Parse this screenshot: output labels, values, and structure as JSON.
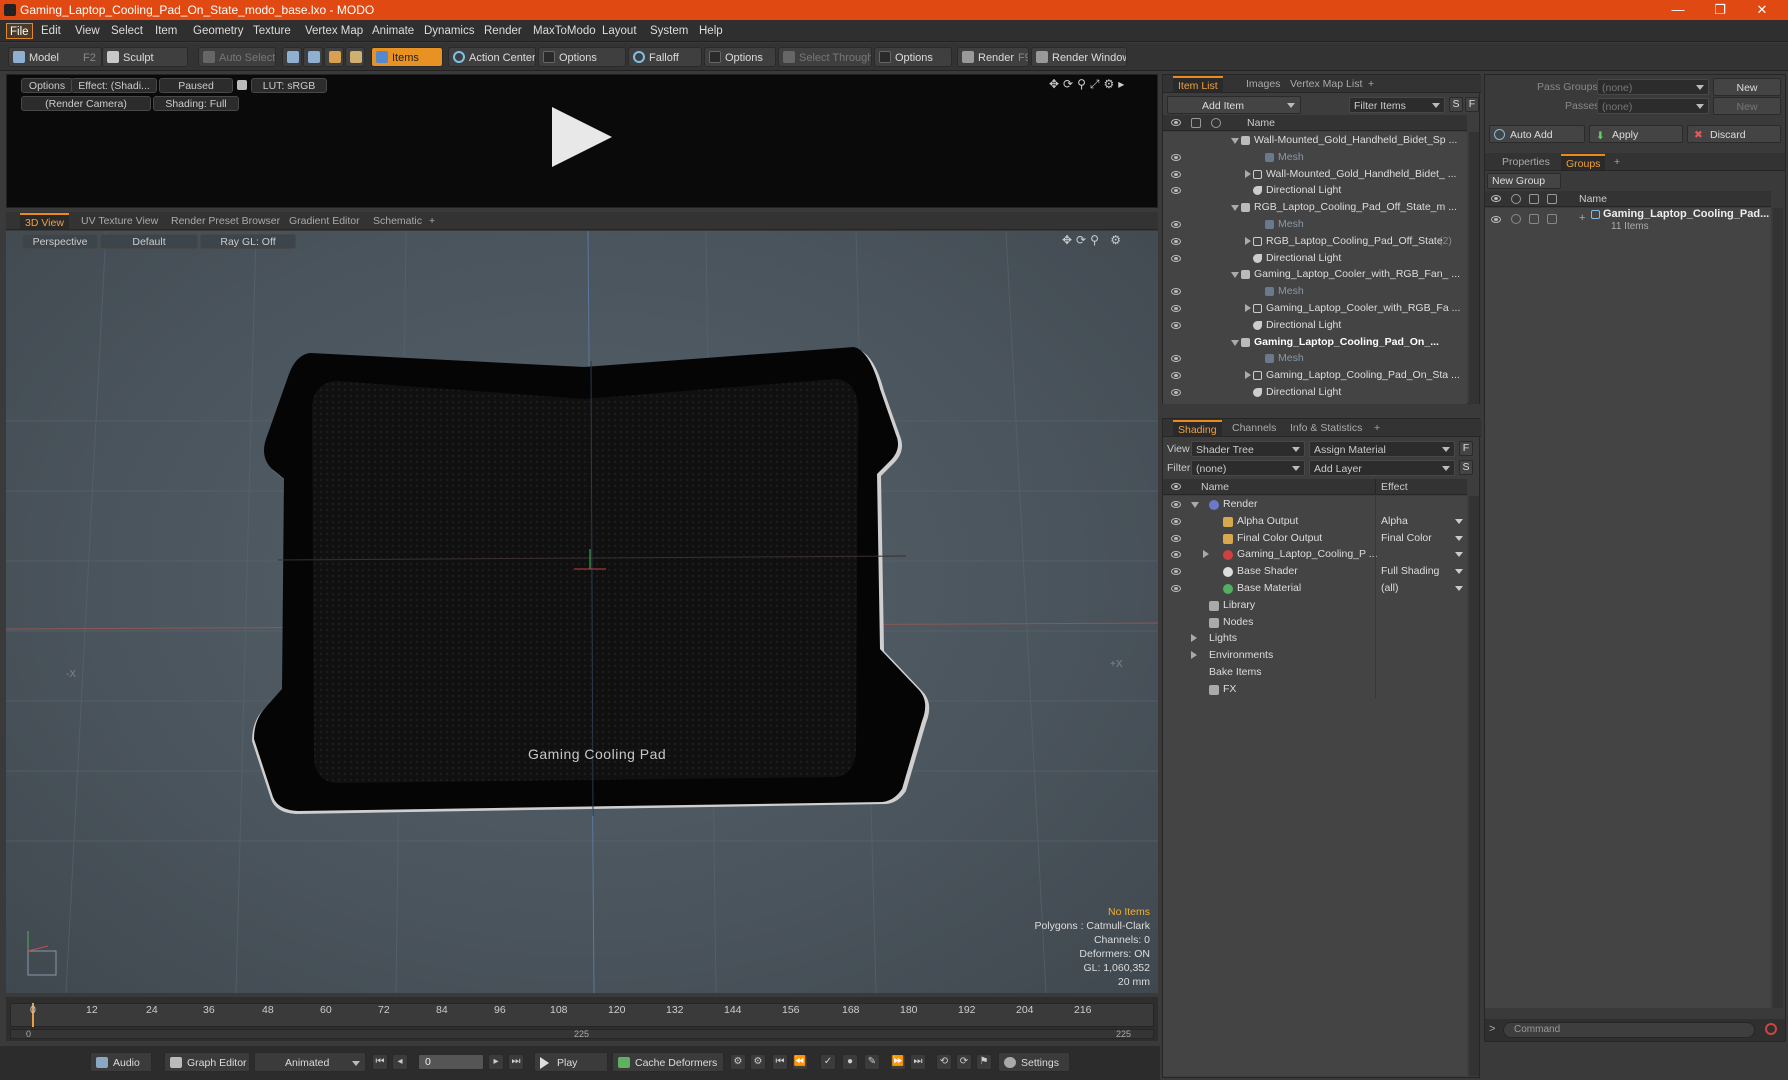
{
  "window": {
    "title": "Gaming_Laptop_Cooling_Pad_On_State_modo_base.lxo - MODO",
    "min": "—",
    "restore": "❐",
    "close": "✕"
  },
  "menu": [
    "File",
    "Edit",
    "View",
    "Select",
    "Item",
    "Geometry",
    "Texture",
    "Vertex Map",
    "Animate",
    "Dynamics",
    "Render",
    "MaxToModo",
    "Layout",
    "System",
    "Help"
  ],
  "toolbar": {
    "model": "Model",
    "model_key": "F2",
    "sculpt": "Sculpt",
    "auto_select": "Auto Select",
    "items": "Items",
    "action_center": "Action Center",
    "options1": "Options",
    "falloff": "Falloff",
    "options2": "Options",
    "select_through": "Select Through",
    "options3": "Options",
    "render": "Render",
    "render_key": "F9",
    "render_window": "Render Window"
  },
  "preview": {
    "options": "Options",
    "effect": "Effect: (Shadi...",
    "paused": "Paused",
    "lut": "LUT: sRGB",
    "camera": "(Render Camera)",
    "shading": "Shading: Full"
  },
  "viewport_tabs": [
    "3D View",
    "UV Texture View",
    "Render Preset Browser",
    "Gradient Editor",
    "Schematic",
    "+"
  ],
  "viewport": {
    "perspective": "Perspective",
    "default": "Default",
    "raygl": "Ray GL: Off",
    "pad_label": "Gaming Cooling Pad",
    "axis_neg_x": "-X",
    "axis_pos_x": "+X"
  },
  "viewport_status": {
    "no_items": "No Items",
    "polygons": "Polygons : Catmull-Clark",
    "channels": "Channels: 0",
    "deformers": "Deformers: ON",
    "gl": "GL: 1,060,352",
    "scale": "20 mm"
  },
  "item_list": {
    "tabs": [
      "Item List",
      "Images",
      "Vertex Map List",
      "+"
    ],
    "add_item": "Add Item",
    "filter_items": "Filter Items",
    "s": "S",
    "f": "F",
    "col_name": "Name",
    "rows": [
      {
        "label": "Wall-Mounted_Gold_Handheld_Bidet_Sp ...",
        "indent": 0,
        "kind": "scene"
      },
      {
        "label": "Mesh",
        "indent": 2,
        "kind": "mesh"
      },
      {
        "label": "Wall-Mounted_Gold_Handheld_Bidet_ ...",
        "indent": 1,
        "kind": "group"
      },
      {
        "label": "Directional Light",
        "indent": 1,
        "kind": "light"
      },
      {
        "label": "RGB_Laptop_Cooling_Pad_Off_State_m ...",
        "indent": 0,
        "kind": "scene"
      },
      {
        "label": "Mesh",
        "indent": 2,
        "kind": "mesh"
      },
      {
        "label": "RGB_Laptop_Cooling_Pad_Off_State",
        "indent": 1,
        "kind": "group",
        "suffix": "(2)"
      },
      {
        "label": "Directional Light",
        "indent": 1,
        "kind": "light"
      },
      {
        "label": "Gaming_Laptop_Cooler_with_RGB_Fan_ ...",
        "indent": 0,
        "kind": "scene"
      },
      {
        "label": "Mesh",
        "indent": 2,
        "kind": "mesh"
      },
      {
        "label": "Gaming_Laptop_Cooler_with_RGB_Fa ...",
        "indent": 1,
        "kind": "group"
      },
      {
        "label": "Directional Light",
        "indent": 1,
        "kind": "light"
      },
      {
        "label": "Gaming_Laptop_Cooling_Pad_On_...",
        "indent": 0,
        "kind": "scene",
        "bold": true
      },
      {
        "label": "Mesh",
        "indent": 2,
        "kind": "mesh"
      },
      {
        "label": "Gaming_Laptop_Cooling_Pad_On_Sta ...",
        "indent": 1,
        "kind": "group"
      },
      {
        "label": "Directional Light",
        "indent": 1,
        "kind": "light"
      }
    ]
  },
  "shading": {
    "tabs": [
      "Shading",
      "Channels",
      "Info & Statistics",
      "+"
    ],
    "view_label": "View",
    "view_value": "Shader Tree",
    "assign_material": "Assign Material",
    "f": "F",
    "filter_label": "Filter",
    "filter_value": "(none)",
    "add_layer": "Add Layer",
    "s": "S",
    "col_name": "Name",
    "col_effect": "Effect",
    "rows": [
      {
        "label": "Render",
        "effect": "",
        "indent": 0
      },
      {
        "label": "Alpha Output",
        "effect": "Alpha",
        "indent": 1
      },
      {
        "label": "Final Color Output",
        "effect": "Final Color",
        "indent": 1
      },
      {
        "label": "Gaming_Laptop_Cooling_P ...",
        "effect": "",
        "indent": 1
      },
      {
        "label": "Base Shader",
        "effect": "Full Shading",
        "indent": 1
      },
      {
        "label": "Base Material",
        "effect": "(all)",
        "indent": 1
      },
      {
        "label": "Library",
        "effect": "",
        "indent": 1
      },
      {
        "label": "Nodes",
        "effect": "",
        "indent": 1
      },
      {
        "label": "Lights",
        "effect": "",
        "indent": 0
      },
      {
        "label": "Environments",
        "effect": "",
        "indent": 0
      },
      {
        "label": "Bake Items",
        "effect": "",
        "indent": 0
      },
      {
        "label": "FX",
        "effect": "",
        "indent": 1
      }
    ]
  },
  "groups_panel": {
    "pass_groups": "Pass Groups",
    "pass_groups_value": "(none)",
    "new": "New",
    "passes": "Passes",
    "passes_value": "(none)",
    "new2": "New",
    "auto_add": "Auto Add",
    "apply": "Apply",
    "discard": "Discard",
    "tabs": [
      "Properties",
      "Groups",
      "+"
    ],
    "new_group": "New Group",
    "col_name": "Name",
    "group_name": "Gaming_Laptop_Cooling_Pad...",
    "group_count": "11 Items"
  },
  "timeline": {
    "ticks": [
      "0",
      "12",
      "24",
      "36",
      "48",
      "60",
      "72",
      "84",
      "96",
      "108",
      "120",
      "132",
      "144",
      "156",
      "168",
      "180",
      "192",
      "204",
      "216"
    ],
    "start": "0",
    "mid": "225",
    "end": "225"
  },
  "bottom": {
    "audio": "Audio",
    "graph_editor": "Graph Editor",
    "animated": "Animated",
    "frame": "0",
    "play": "Play",
    "cache_deformers": "Cache Deformers",
    "settings": "Settings",
    "command": "Command"
  },
  "colors": {
    "accent": "#e88a20",
    "title": "#e04a12",
    "viewport": "#4e5860"
  }
}
